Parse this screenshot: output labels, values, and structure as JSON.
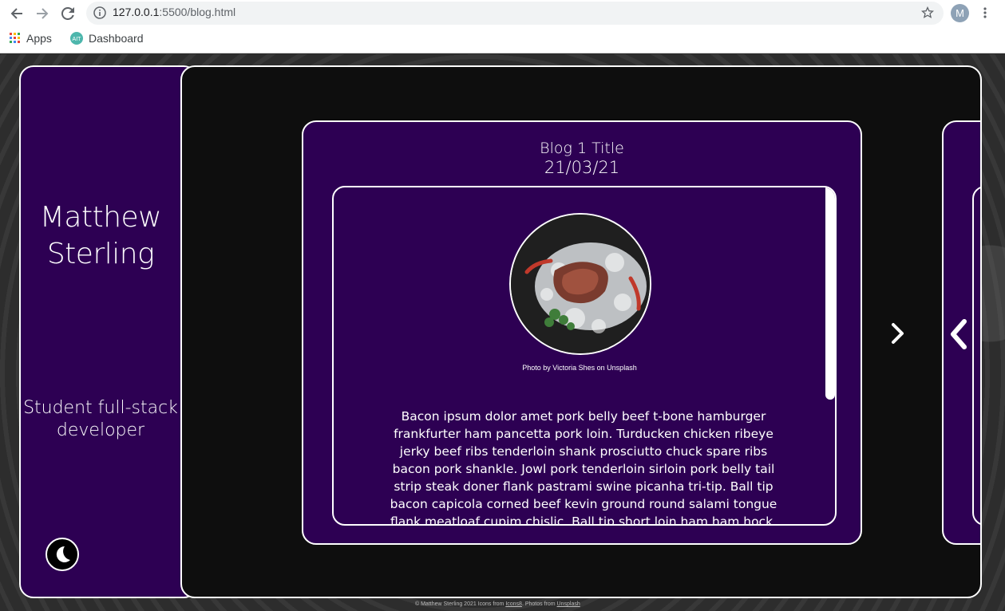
{
  "browser": {
    "url_host": "127.0.0.1",
    "url_path": ":5500/blog.html",
    "avatar_letter": "M",
    "bookmarks": [
      {
        "label": "Apps",
        "icon": "apps-grid-icon"
      },
      {
        "label": "Dashboard",
        "icon": "dashboard-icon"
      }
    ]
  },
  "sidebar": {
    "name": "Matthew Sterling",
    "role": "Student full-stack developer",
    "theme_toggle_icon": "moon-icon"
  },
  "blog_card": {
    "title": "Blog 1 Title",
    "date": "21/03/21",
    "photo_caption": "Photo by Victoria Shes on Unsplash",
    "body": "Bacon ipsum dolor amet pork belly beef t-bone hamburger frankfurter ham pancetta pork loin. Turducken chicken ribeye jerky beef ribs tenderloin shank prosciutto chuck spare ribs bacon pork shankle. Jowl pork tenderloin sirloin pork belly tail strip steak doner flank pastrami swine picanha tri-tip. Ball tip bacon capicola corned beef kevin ground round salami tongue flank meatloaf cupim chislic. Ball tip short loin ham ham hock, cow chislic"
  },
  "nav": {
    "next_icon": "chevron-right-icon",
    "prev_icon": "chevron-left-icon"
  },
  "footer": {
    "text": "© Matthew Sterling 2021 Icons from",
    "link1": "Icons8",
    "mid": ". Photos from",
    "link2": "Unsplash"
  },
  "colors": {
    "panel_purple": "#2d0053",
    "main_black": "#0e0e0e",
    "border": "#ffffff"
  }
}
